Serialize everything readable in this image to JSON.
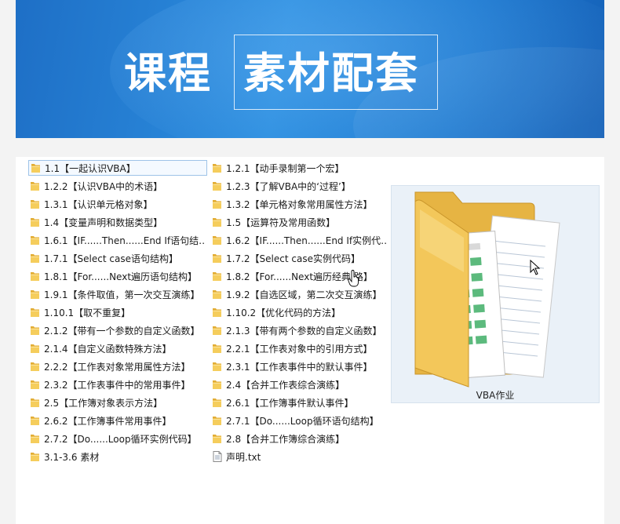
{
  "banner": {
    "title_part1": "课程",
    "title_part2": "素材配套"
  },
  "files": {
    "col1": [
      {
        "label": "1.1【一起认识VBA】",
        "type": "folder"
      },
      {
        "label": "1.2.2【认识VBA中的术语】",
        "type": "folder"
      },
      {
        "label": "1.3.1【认识单元格对象】",
        "type": "folder"
      },
      {
        "label": "1.4【变量声明和数据类型】",
        "type": "folder"
      },
      {
        "label": "1.6.1【IF......Then......End If语句结…",
        "type": "folder"
      },
      {
        "label": "1.7.1【Select  case语句结构】",
        "type": "folder"
      },
      {
        "label": "1.8.1【For......Next遍历语句结构】",
        "type": "folder"
      },
      {
        "label": "1.9.1【条件取值，第一次交互演练】",
        "type": "folder"
      },
      {
        "label": "1.10.1【取不重复】",
        "type": "folder"
      },
      {
        "label": "2.1.2【带有一个参数的自定义函数】",
        "type": "folder"
      },
      {
        "label": "2.1.4【自定义函数特殊方法】",
        "type": "folder"
      },
      {
        "label": "2.2.2【工作表对象常用属性方法】",
        "type": "folder"
      },
      {
        "label": "2.3.2【工作表事件中的常用事件】",
        "type": "folder"
      },
      {
        "label": "2.5【工作簿对象表示方法】",
        "type": "folder"
      },
      {
        "label": "2.6.2【工作簿事件常用事件】",
        "type": "folder"
      },
      {
        "label": "2.7.2【Do......Loop循环实例代码】",
        "type": "folder"
      },
      {
        "label": "3.1-3.6 素材",
        "type": "folder"
      }
    ],
    "col2": [
      {
        "label": "1.2.1【动手录制第一个宏】",
        "type": "folder"
      },
      {
        "label": "1.2.3【了解VBA中的‘过程’】",
        "type": "folder"
      },
      {
        "label": "1.3.2【单元格对象常用属性方法】",
        "type": "folder"
      },
      {
        "label": "1.5【运算符及常用函数】",
        "type": "folder"
      },
      {
        "label": "1.6.2【IF......Then......End If实例代…",
        "type": "folder"
      },
      {
        "label": "1.7.2【Select  case实例代码】",
        "type": "folder"
      },
      {
        "label": "1.8.2【For......Next遍历经典   路】",
        "type": "folder"
      },
      {
        "label": "1.9.2【自选区域，第二次交互演练】",
        "type": "folder"
      },
      {
        "label": "1.10.2【优化代码的方法】",
        "type": "folder"
      },
      {
        "label": "2.1.3【带有两个参数的自定义函数】",
        "type": "folder"
      },
      {
        "label": "2.2.1【工作表对象中的引用方式】",
        "type": "folder"
      },
      {
        "label": "2.3.1【工作表事件中的默认事件】",
        "type": "folder"
      },
      {
        "label": "2.4【合并工作表综合演练】",
        "type": "folder"
      },
      {
        "label": "2.6.1【工作簿事件默认事件】",
        "type": "folder"
      },
      {
        "label": "2.7.1【Do......Loop循环语句结构】",
        "type": "folder"
      },
      {
        "label": "2.8【合并工作簿综合演练】",
        "type": "folder"
      },
      {
        "label": "声明.txt",
        "type": "file"
      }
    ]
  },
  "preview": {
    "caption": "VBA作业",
    "icon": "folder-large-icon"
  },
  "colors": {
    "banner_blue": "#2d8fe0",
    "folder_yellow": "#f3c75a",
    "selection_border": "#9ec3e8"
  }
}
